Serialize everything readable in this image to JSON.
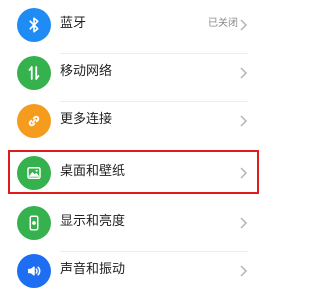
{
  "settings": {
    "items": [
      {
        "label": "蓝牙",
        "status": "已关闭",
        "icon": "bluetooth-icon",
        "color": "#1e8cf4"
      },
      {
        "label": "移动网络",
        "status": "",
        "icon": "mobile-data-icon",
        "color": "#35b14d"
      },
      {
        "label": "更多连接",
        "status": "",
        "icon": "link-icon",
        "color": "#f59b1e"
      },
      {
        "label": "桌面和壁纸",
        "status": "",
        "icon": "wallpaper-icon",
        "color": "#35b14d"
      },
      {
        "label": "显示和亮度",
        "status": "",
        "icon": "display-brightness-icon",
        "color": "#35b14d"
      },
      {
        "label": "声音和振动",
        "status": "",
        "icon": "sound-icon",
        "color": "#1e6ef4"
      }
    ]
  },
  "highlight": {
    "item_label": "桌面和壁纸",
    "color": "#e01b1b"
  }
}
